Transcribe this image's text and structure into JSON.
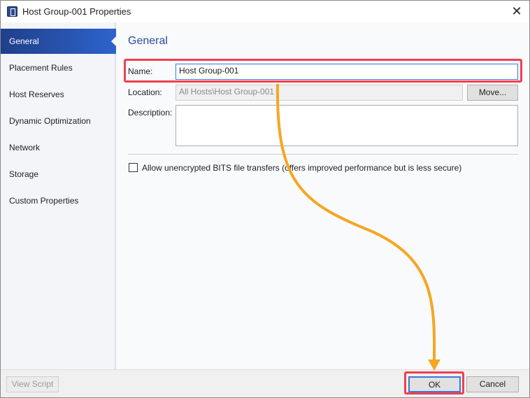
{
  "window": {
    "title": "Host Group-001 Properties",
    "close_icon": "close-icon",
    "app_icon": "host-group-icon"
  },
  "sidebar": {
    "items": [
      {
        "label": "General",
        "active": true
      },
      {
        "label": "Placement Rules"
      },
      {
        "label": "Host Reserves"
      },
      {
        "label": "Dynamic Optimization"
      },
      {
        "label": "Network"
      },
      {
        "label": "Storage"
      },
      {
        "label": "Custom Properties"
      }
    ]
  },
  "general": {
    "heading": "General",
    "name_label": "Name:",
    "name_value": "Host Group-001",
    "location_label": "Location:",
    "location_value": "All Hosts\\Host Group-001",
    "move_button": "Move...",
    "description_label": "Description:",
    "description_value": "",
    "bits_checkbox_label": "Allow unencrypted BITS file transfers (offers improved performance but is less secure)",
    "bits_checked": false
  },
  "footer": {
    "view_script": "View Script",
    "ok": "OK",
    "cancel": "Cancel"
  },
  "annotation": {
    "highlight_color": "#f04050",
    "arrow_color": "#f5a623"
  }
}
